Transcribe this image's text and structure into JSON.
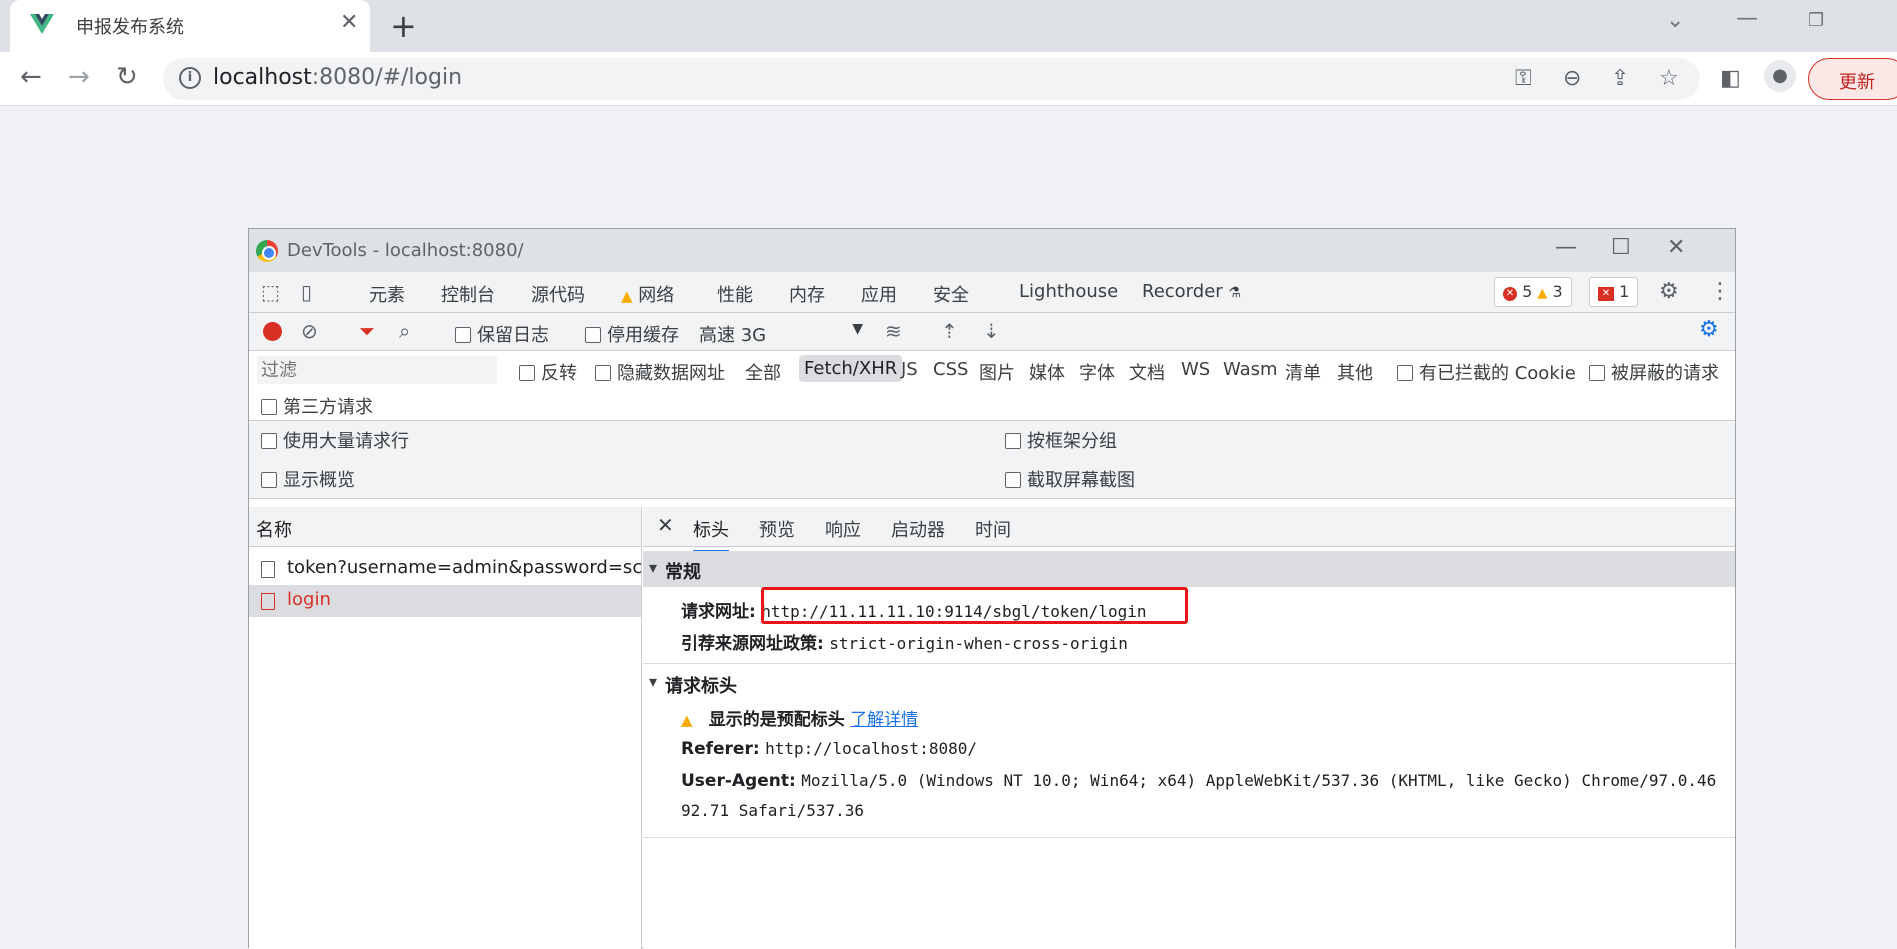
{
  "browser": {
    "tab_title": "申报发布系统",
    "url_host": "localhost",
    "url_rest": ":8080/#/login",
    "update_label": "更新"
  },
  "devtools": {
    "window_title": "DevTools - localhost:8080/",
    "tabs": [
      "元素",
      "控制台",
      "源代码",
      "网络",
      "性能",
      "内存",
      "应用",
      "安全",
      "Lighthouse",
      "Recorder"
    ],
    "issues": {
      "errors": "5",
      "warnings": "3",
      "messages": "1"
    },
    "toolbar": {
      "preserve_log": "保留日志",
      "disable_cache": "停用缓存",
      "throttle": "高速 3G"
    },
    "filter": {
      "placeholder": "过滤",
      "invert": "反转",
      "hide_data_urls": "隐藏数据网址",
      "types": [
        "全部",
        "Fetch/XHR",
        "JS",
        "CSS",
        "图片",
        "媒体",
        "字体",
        "文档",
        "WS",
        "Wasm",
        "清单",
        "其他"
      ],
      "blocked_cookies": "有已拦截的 Cookie",
      "blocked_requests": "被屏蔽的请求",
      "third_party": "第三方请求"
    },
    "settings": {
      "large_rows": "使用大量请求行",
      "group_by_frame": "按框架分组",
      "show_overview": "显示概览",
      "capture_screenshots": "截取屏幕截图"
    },
    "list": {
      "header": "名称",
      "rows": [
        "token?username=admin&password=scyc...",
        "login"
      ]
    },
    "detail": {
      "tabs": [
        "标头",
        "预览",
        "响应",
        "启动器",
        "时间"
      ],
      "general_title": "常规",
      "request_url_label": "请求网址:",
      "request_url": "http://11.11.11.10:9114/sbgl/token/login",
      "referrer_policy_label": "引荐来源网址政策:",
      "referrer_policy": "strict-origin-when-cross-origin",
      "request_headers_title": "请求标头",
      "provisional_warning": "显示的是预配标头",
      "learn_more": "了解详情",
      "referer_label": "Referer:",
      "referer": "http://localhost:8080/",
      "user_agent_label": "User-Agent:",
      "user_agent_line1": "Mozilla/5.0 (Windows NT 10.0; Win64; x64) AppleWebKit/537.36 (KHTML, like Gecko) Chrome/97.0.46",
      "user_agent_line2": "92.71 Safari/537.36"
    }
  }
}
